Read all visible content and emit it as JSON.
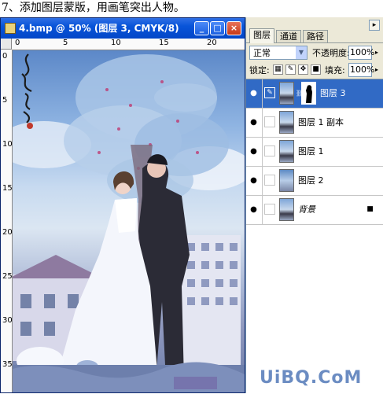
{
  "caption": "7、添加图层蒙版，用画笔突出人物。",
  "doc_window": {
    "title": "4.bmp @ 50% (图层 3, CMYK/8)",
    "buttons": {
      "minimize": "_",
      "maximize": "□",
      "close": "×"
    },
    "ruler_top_labels": [
      "0",
      "5",
      "10",
      "15",
      "20"
    ],
    "ruler_left_labels": [
      "0",
      "5",
      "10",
      "15",
      "20",
      "25",
      "30",
      "35"
    ]
  },
  "layers_panel": {
    "tabs": [
      "图层",
      "通道",
      "路径"
    ],
    "active_tab": "图层",
    "blend_mode": "正常",
    "opacity_label": "不透明度:",
    "opacity_value": "100%",
    "lock_label": "锁定:",
    "fill_label": "填充:",
    "fill_value": "100%",
    "layers": [
      {
        "name": "图层 3",
        "selected": true,
        "has_mask": true
      },
      {
        "name": "图层 1 副本",
        "selected": false,
        "has_mask": false
      },
      {
        "name": "图层 1",
        "selected": false,
        "has_mask": false
      },
      {
        "name": "图层 2",
        "selected": false,
        "has_mask": false
      },
      {
        "name": "背景",
        "selected": false,
        "locked": true
      }
    ]
  },
  "watermark": {
    "site": "UiBQ.CoM"
  },
  "colors": {
    "titlebar": "#0854d8",
    "selection": "#316ac5",
    "panel_bg": "#ece9d8"
  }
}
